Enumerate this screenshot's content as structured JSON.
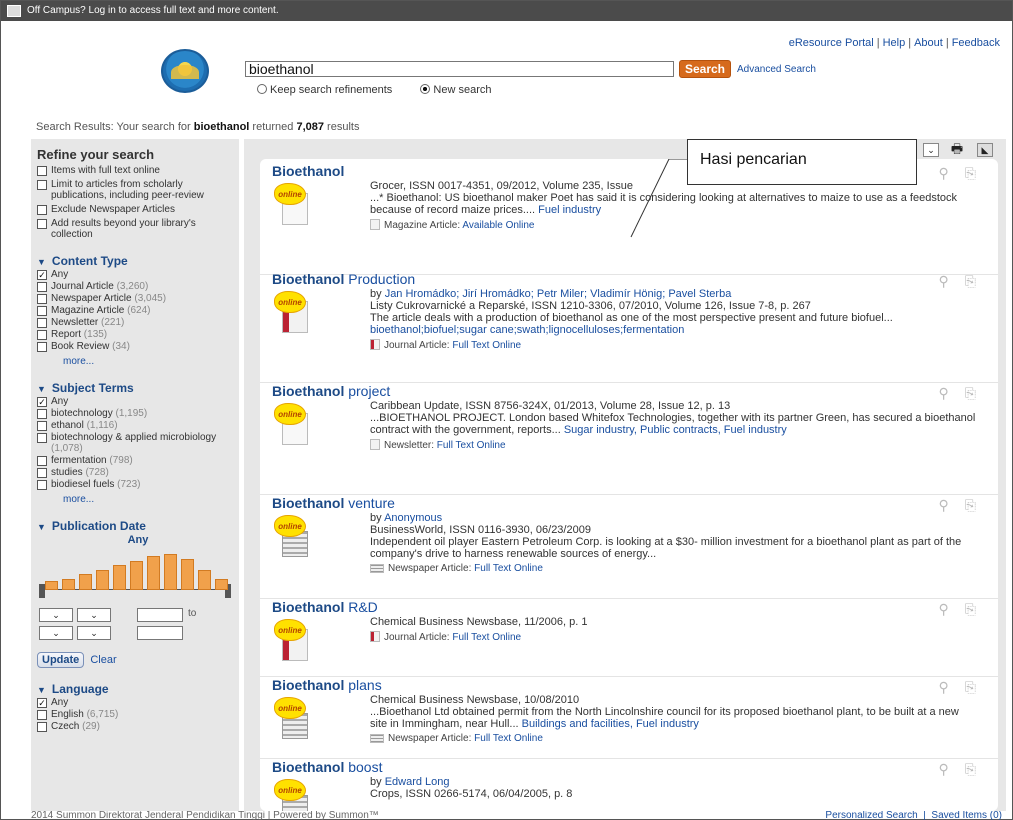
{
  "topbar": {
    "text": "Off Campus? Log in to access full text and more content."
  },
  "toplinks": [
    "eResource Portal",
    "Help",
    "About",
    "Feedback"
  ],
  "search": {
    "value": "bioethanol",
    "button": "Search",
    "advanced": "Advanced Search",
    "opt_keep": "Keep search refinements",
    "opt_new": "New search"
  },
  "summary": {
    "prefix": "Search Results: Your search for ",
    "query": "bioethanol",
    "mid": " returned ",
    "count": "7,087",
    "suffix": " results"
  },
  "sidebar": {
    "title": "Refine your search",
    "refine": [
      "Items with full text online",
      "Limit to articles from scholarly publications, including peer-review",
      "Exclude Newspaper Articles",
      "Add results beyond your library's collection"
    ],
    "content_type": {
      "title": "Content Type",
      "any": "Any",
      "items": [
        [
          "Journal Article",
          "(3,260)"
        ],
        [
          "Newspaper Article",
          "(3,045)"
        ],
        [
          "Magazine Article",
          "(624)"
        ],
        [
          "Newsletter",
          "(221)"
        ],
        [
          "Report",
          "(135)"
        ],
        [
          "Book Review",
          "(34)"
        ]
      ],
      "more": "more..."
    },
    "subject_terms": {
      "title": "Subject Terms",
      "any": "Any",
      "items": [
        [
          "biotechnology",
          "(1,195)"
        ],
        [
          "ethanol",
          "(1,116)"
        ],
        [
          "biotechnology & applied microbiology",
          "(1,078)"
        ],
        [
          "fermentation",
          "(798)"
        ],
        [
          "studies",
          "(728)"
        ],
        [
          "biodiesel fuels",
          "(723)"
        ]
      ],
      "more": "more..."
    },
    "publication_date": {
      "title": "Publication Date",
      "value": "Any",
      "to": "to",
      "update": "Update",
      "clear": "Clear",
      "histogram": [
        0.25,
        0.3,
        0.45,
        0.55,
        0.7,
        0.8,
        0.95,
        1.0,
        0.85,
        0.55,
        0.3
      ]
    },
    "language": {
      "title": "Language",
      "any": "Any",
      "items": [
        [
          "English",
          "(6,715)"
        ],
        [
          "Czech",
          "(29)"
        ]
      ]
    }
  },
  "callout": "Hasi pencarian",
  "results": [
    {
      "title_bold": "Bioethanol",
      "title_rest": "",
      "author": "",
      "source": "Grocer, ISSN 0017-4351, 09/2012, Volume 235, Issue",
      "snippet": "...* Bioethanol: US bioethanol maker Poet has said it is considering looking at alternatives to maize to use as a feedstock because of record maize prices....",
      "subjects": "Fuel industry",
      "type": "Magazine Article:",
      "avail": "Available Online"
    },
    {
      "title_bold": "Bioethanol",
      "title_rest": " Production",
      "author": "Jan Hromádko; Jirí Hromádko; Petr Miler; Vladimír Hönig; Pavel Sterba",
      "source": "Listy Cukrovarnické a Reparské, ISSN 1210-3306, 07/2010, Volume 126, Issue 7-8, p. 267",
      "snippet": "The article deals with a production of bioethanol as one of the most perspective present and future biofuel...",
      "subjects": "bioethanol;biofuel;sugar cane;swath;lignocelluloses;fermentation",
      "type": "Journal Article:",
      "avail": "Full Text Online"
    },
    {
      "title_bold": "Bioethanol",
      "title_rest": " project",
      "author": "",
      "source": "Caribbean Update, ISSN 8756-324X, 01/2013, Volume 28, Issue 12, p. 13",
      "snippet": "...BIOETHANOL PROJECT. London based Whitefox Technologies, together with its partner Green, has secured a bioethanol contract with the government, reports...",
      "subjects": "Sugar industry, Public contracts, Fuel industry",
      "type": "Newsletter:",
      "avail": "Full Text Online"
    },
    {
      "title_bold": "Bioethanol",
      "title_rest": " venture",
      "author": "Anonymous",
      "source": "BusinessWorld, ISSN 0116-3930, 06/23/2009",
      "snippet": "Independent oil player Eastern Petroleum Corp. is looking at a $30- million investment for a bioethanol plant as part of the company's drive to harness renewable sources of energy...",
      "subjects": "",
      "type": "Newspaper Article:",
      "avail": "Full Text Online"
    },
    {
      "title_bold": "Bioethanol",
      "title_rest": " R&D",
      "author": "",
      "source": "Chemical Business Newsbase, 11/2006, p. 1",
      "snippet": "",
      "subjects": "",
      "type": "Journal Article:",
      "avail": "Full Text Online"
    },
    {
      "title_bold": "Bioethanol",
      "title_rest": " plans",
      "author": "",
      "source": "Chemical Business Newsbase, 10/08/2010",
      "snippet": "...Bioethanol Ltd obtained permit from the North Lincolnshire council for its proposed bioethanol plant, to be built at a new site in Immingham, near Hull...",
      "subjects": "Buildings and facilities, Fuel industry",
      "type": "Newspaper Article:",
      "avail": "Full Text Online"
    },
    {
      "title_bold": "Bioethanol",
      "title_rest": " boost",
      "author": "Edward Long",
      "source": "Crops, ISSN 0266-5174, 06/04/2005, p. 8",
      "snippet": "",
      "subjects": "",
      "type": "",
      "avail": ""
    }
  ],
  "footer": {
    "left": "2014 Summon Direktorat Jenderal Pendidikan Tinggi | Powered by Summon™",
    "personalized": "Personalized Search",
    "saved": "Saved Items (0)"
  }
}
